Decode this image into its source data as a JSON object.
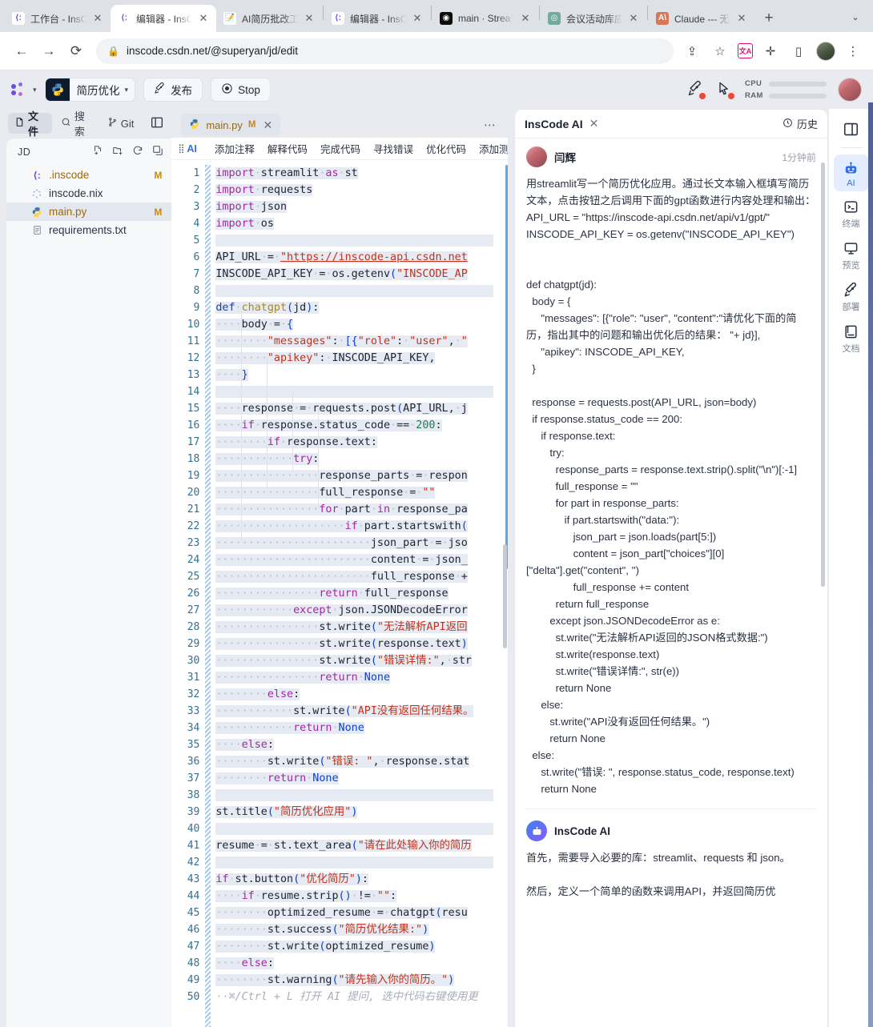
{
  "browser": {
    "tabs": [
      {
        "title": "工作台 - InsC",
        "icon": "inscode-icon",
        "active": false
      },
      {
        "title": "编辑器 - InsC",
        "icon": "inscode-icon",
        "active": true
      },
      {
        "title": "AI简历批改工",
        "icon": "pencil-icon",
        "active": false
      },
      {
        "title": "编辑器 - InsC",
        "icon": "inscode-icon",
        "active": false
      },
      {
        "title": "main · Strea",
        "icon": "streamlit-icon",
        "active": false
      },
      {
        "title": "会议活动库应",
        "icon": "openai-icon",
        "active": false
      },
      {
        "title": "Claude --- 无",
        "icon": "claude-icon",
        "active": false
      }
    ],
    "new_tab_label": "+",
    "tab_list_label": "⌄",
    "url": "inscode.csdn.net/@superyan/jd/edit",
    "nav": {
      "back": "←",
      "forward": "→",
      "reload": "⟳"
    },
    "lock_icon": "lock-icon",
    "actions": [
      "share-icon",
      "bookmark-star-icon",
      "translate-extension-icon",
      "extensions-icon",
      "sidepanel-icon",
      "profile-avatar",
      "chrome-menu-icon"
    ]
  },
  "apptop": {
    "logo": "inscode-logo",
    "project_name": "简历优化",
    "project_icon": "python-icon",
    "publish_label": "发布",
    "publish_icon": "rocket-icon",
    "stop_label": "Stop",
    "stop_icon": "stop-circle-icon",
    "notif_icons": [
      "rocket-alert-icon",
      "cursor-alert-icon"
    ],
    "meters": [
      {
        "label": "CPU",
        "fill_pct": 6
      },
      {
        "label": "RAM",
        "fill_pct": 22
      }
    ]
  },
  "sidebar": {
    "tabs": [
      {
        "label": "文件",
        "icon": "file-icon",
        "selected": true
      },
      {
        "label": "搜索",
        "icon": "search-icon",
        "selected": false
      },
      {
        "label": "Git",
        "icon": "git-branch-icon",
        "selected": false
      }
    ],
    "layout_toggle_icon": "panel-layout-icon",
    "root_label": "JD",
    "actions": [
      "new-file-icon",
      "new-folder-icon",
      "refresh-icon",
      "collapse-all-icon"
    ],
    "files": [
      {
        "name": ".inscode",
        "icon": "inscode-icon",
        "status": "M",
        "selected": false,
        "modified": true
      },
      {
        "name": "inscode.nix",
        "icon": "nix-icon",
        "status": "",
        "selected": false,
        "modified": false
      },
      {
        "name": "main.py",
        "icon": "python-icon",
        "status": "M",
        "selected": true,
        "modified": true
      },
      {
        "name": "requirements.txt",
        "icon": "text-file-icon",
        "status": "",
        "selected": false,
        "modified": false
      }
    ]
  },
  "editor": {
    "tab": {
      "filename": "main.py",
      "status": "M",
      "icon": "python-icon",
      "close": "✕"
    },
    "more_icon": "more-horizontal-icon",
    "ai_bar": {
      "grip_icon": "drag-grip-icon",
      "label": "AI",
      "actions": [
        "添加注释",
        "解释代码",
        "完成代码",
        "寻找错误",
        "优化代码",
        "添加测"
      ]
    },
    "line_count": 50,
    "lines": [
      {
        "n": 1,
        "text": "import streamlit as st"
      },
      {
        "n": 2,
        "text": "import requests"
      },
      {
        "n": 3,
        "text": "import json"
      },
      {
        "n": 4,
        "text": "import os"
      },
      {
        "n": 5,
        "text": ""
      },
      {
        "n": 6,
        "text": "API_URL = \"https://inscode-api.csdn.net"
      },
      {
        "n": 7,
        "text": "INSCODE_API_KEY = os.getenv(\"INSCODE_AP"
      },
      {
        "n": 8,
        "text": ""
      },
      {
        "n": 9,
        "text": "def chatgpt(jd):"
      },
      {
        "n": 10,
        "text": "    body = {"
      },
      {
        "n": 11,
        "text": "        \"messages\": [{\"role\": \"user\", \""
      },
      {
        "n": 12,
        "text": "        \"apikey\": INSCODE_API_KEY,"
      },
      {
        "n": 13,
        "text": "    }"
      },
      {
        "n": 14,
        "text": ""
      },
      {
        "n": 15,
        "text": "    response = requests.post(API_URL, j"
      },
      {
        "n": 16,
        "text": "    if response.status_code == 200:"
      },
      {
        "n": 17,
        "text": "        if response.text:"
      },
      {
        "n": 18,
        "text": "            try:"
      },
      {
        "n": 19,
        "text": "                response_parts = respon"
      },
      {
        "n": 20,
        "text": "                full_response = \"\""
      },
      {
        "n": 21,
        "text": "                for part in response_pa"
      },
      {
        "n": 22,
        "text": "                    if part.startswith("
      },
      {
        "n": 23,
        "text": "                        json_part = jso"
      },
      {
        "n": 24,
        "text": "                        content = json_"
      },
      {
        "n": 25,
        "text": "                        full_response +"
      },
      {
        "n": 26,
        "text": "                return full_response"
      },
      {
        "n": 27,
        "text": "            except json.JSONDecodeError"
      },
      {
        "n": 28,
        "text": "                st.write(\"无法解析API返回"
      },
      {
        "n": 29,
        "text": "                st.write(response.text)"
      },
      {
        "n": 30,
        "text": "                st.write(\"错误详情:\", str"
      },
      {
        "n": 31,
        "text": "                return None"
      },
      {
        "n": 32,
        "text": "        else:"
      },
      {
        "n": 33,
        "text": "            st.write(\"API没有返回任何结果。"
      },
      {
        "n": 34,
        "text": "            return None"
      },
      {
        "n": 35,
        "text": "    else:"
      },
      {
        "n": 36,
        "text": "        st.write(\"错误: \", response.stat"
      },
      {
        "n": 37,
        "text": "        return None"
      },
      {
        "n": 38,
        "text": ""
      },
      {
        "n": 39,
        "text": "st.title(\"简历优化应用\")"
      },
      {
        "n": 40,
        "text": ""
      },
      {
        "n": 41,
        "text": "resume = st.text_area(\"请在此处输入你的简历"
      },
      {
        "n": 42,
        "text": ""
      },
      {
        "n": 43,
        "text": "if st.button(\"优化简历\"):"
      },
      {
        "n": 44,
        "text": "    if resume.strip() != \"\":"
      },
      {
        "n": 45,
        "text": "        optimized_resume = chatgpt(resu"
      },
      {
        "n": 46,
        "text": "        st.success(\"简历优化结果:\")"
      },
      {
        "n": 47,
        "text": "        st.write(optimized_resume)"
      },
      {
        "n": 48,
        "text": "    else:"
      },
      {
        "n": 49,
        "text": "        st.warning(\"请先输入你的简历。\")"
      },
      {
        "n": 50,
        "text": "⌘/Ctrl + L 打开 AI 提问, 选中代码右键使用更"
      }
    ]
  },
  "ai_panel": {
    "title": "InsCode AI",
    "close_icon": "close-icon",
    "history_label": "历史",
    "history_icon": "clock-icon",
    "messages": [
      {
        "author": "闫辉",
        "avatar": "user-avatar",
        "time": "1分钟前",
        "body": "用streamlit写一个简历优化应用。通过长文本输入框填写简历文本，点击按钮之后调用下面的gpt函数进行内容处理和输出： API_URL = \"https://inscode-api.csdn.net/api/v1/gpt/\"\nINSCODE_API_KEY = os.getenv(\"INSCODE_API_KEY\")\n\n\ndef chatgpt(jd):\n  body = {\n     \"messages\": [{\"role\": \"user\", \"content\":\"请优化下面的简历，指出其中的问题和输出优化后的结果： \"+ jd}],\n     \"apikey\": INSCODE_API_KEY,\n  }\n\n  response = requests.post(API_URL, json=body)\n  if response.status_code == 200:\n     if response.text:\n        try:\n          response_parts = response.text.strip().split(\"\\n\")[:-1]\n          full_response = \"\"\n          for part in response_parts:\n             if part.startswith(\"data:\"):\n                json_part = json.loads(part[5:])\n                content = json_part[\"choices\"][0][\"delta\"].get(\"content\", '')\n                full_response += content\n          return full_response\n        except json.JSONDecodeError as e:\n          st.write(\"无法解析API返回的JSON格式数据:\")\n          st.write(response.text)\n          st.write(\"错误详情:\", str(e))\n          return None\n     else:\n        st.write(\"API没有返回任何结果。\")\n        return None\n  else:\n     st.write(\"错误: \", response.status_code, response.text)\n     return None"
      },
      {
        "author": "InsCode AI",
        "avatar": "bot-avatar",
        "time": "",
        "body": "首先，需要导入必要的库：streamlit、requests 和 json。\n\n然后，定义一个简单的函数来调用API，并返回简历优"
      }
    ]
  },
  "right_rail": {
    "top_icon": "panel-layout-icon",
    "items": [
      {
        "label": "AI",
        "icon": "robot-icon",
        "selected": true
      },
      {
        "label": "终端",
        "icon": "terminal-icon",
        "selected": false
      },
      {
        "label": "预览",
        "icon": "monitor-icon",
        "selected": false
      },
      {
        "label": "部署",
        "icon": "rocket-icon",
        "selected": false
      },
      {
        "label": "文档",
        "icon": "book-icon",
        "selected": false
      }
    ]
  },
  "colors": {
    "accent": "#2f6fed",
    "modified": "#c98a18",
    "chrome_bg": "#dee1e6",
    "app_bg": "#e9ebf0",
    "rail_edge": "#5f6d9a"
  }
}
